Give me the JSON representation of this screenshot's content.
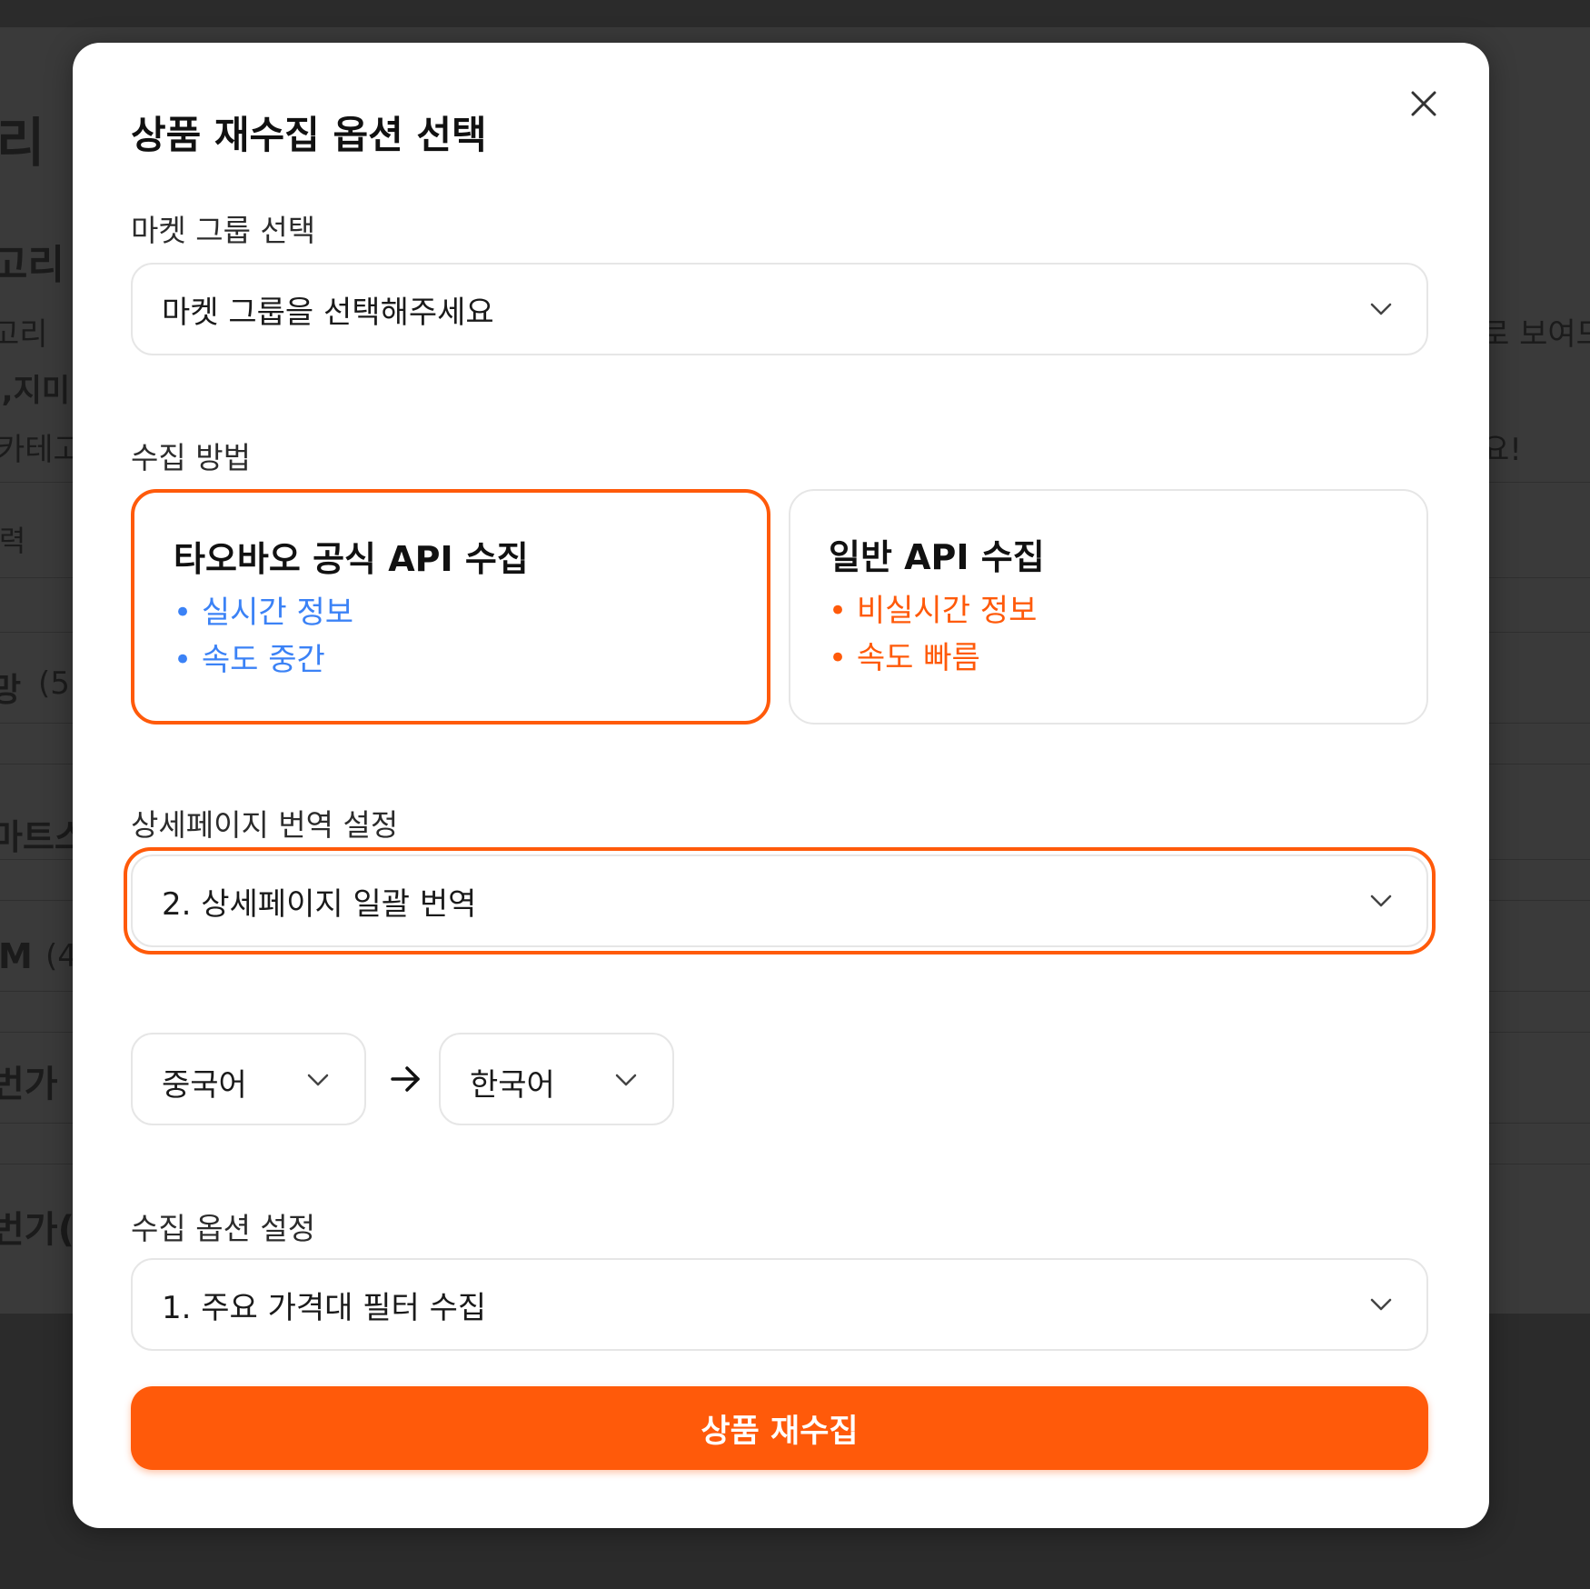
{
  "background": {
    "fragments": [
      "리",
      "고리",
      "고리",
      "l,지미",
      "카테고",
      "l력",
      "망",
      "(5",
      "마트스",
      "M",
      "(4",
      "번가",
      "번가(",
      "로 보여드",
      "요!"
    ]
  },
  "modal": {
    "title": "상품 재수집 옵션 선택",
    "close_icon": "close-icon",
    "market_group": {
      "label": "마켓 그룹 선택",
      "placeholder": "마켓 그룹을 선택해주세요"
    },
    "collect_method": {
      "label": "수집 방법",
      "options": [
        {
          "title": "타오바오 공식 API 수집",
          "bullets": [
            "실시간 정보",
            "속도 중간"
          ],
          "selected": true,
          "color": "#3b82f6"
        },
        {
          "title": "일반 API 수집",
          "bullets": [
            "비실시간 정보",
            "속도 빠름"
          ],
          "selected": false,
          "color": "#ff5a0a"
        }
      ]
    },
    "translation": {
      "label": "상세페이지 번역 설정",
      "value": "2. 상세페이지 일괄 번역",
      "source_lang": "중국어",
      "target_lang": "한국어",
      "arrow_icon": "arrow-right-icon"
    },
    "collect_options": {
      "label": "수집 옵션 설정",
      "value": "1. 주요 가격대 필터 수집"
    },
    "submit_label": "상품 재수집"
  },
  "colors": {
    "accent": "#ff5a0a",
    "blue": "#3b82f6",
    "border": "#e6e6e6",
    "overlay": "#2b2b2b"
  }
}
